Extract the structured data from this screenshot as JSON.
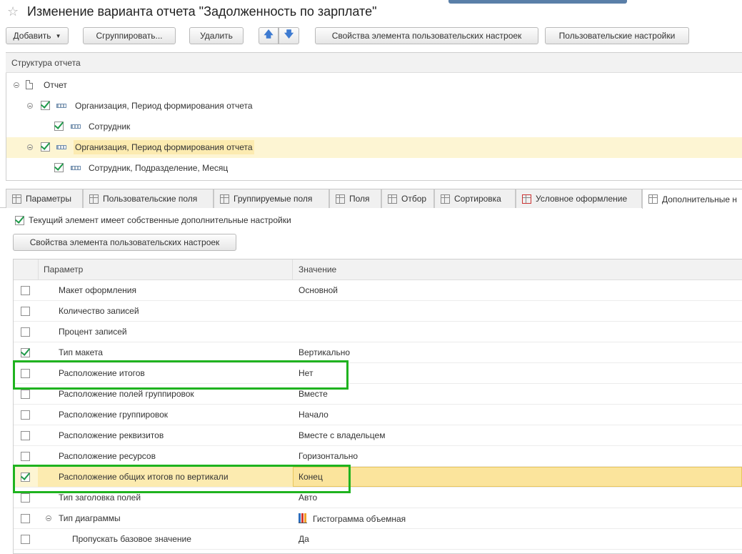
{
  "title": "Изменение варианта отчета \"Задолженность по зарплате\"",
  "toolbar": {
    "add": "Добавить",
    "group": "Сгруппировать...",
    "delete": "Удалить",
    "up_arrow": "🡅",
    "down_arrow": "🡇",
    "element_props": "Свойства элемента пользовательских настроек",
    "user_settings": "Пользовательские настройки"
  },
  "structure": {
    "header": "Структура отчета",
    "items": [
      {
        "label": "Отчет"
      },
      {
        "label": "Организация, Период формирования отчета"
      },
      {
        "label": "Сотрудник"
      },
      {
        "label": "Организация, Период формирования отчета"
      },
      {
        "label": "Сотрудник, Подразделение, Месяц"
      }
    ]
  },
  "tabs": [
    {
      "label": "Параметры"
    },
    {
      "label": "Пользовательские поля"
    },
    {
      "label": "Группируемые поля"
    },
    {
      "label": "Поля"
    },
    {
      "label": "Отбор"
    },
    {
      "label": "Сортировка"
    },
    {
      "label": "Условное оформление"
    },
    {
      "label": "Дополнительные н"
    }
  ],
  "own_settings_label": "Текущий элемент имеет собственные дополнительные настройки",
  "element_props_button": "Свойства элемента пользовательских настроек",
  "grid": {
    "col_param": "Параметр",
    "col_value": "Значение",
    "rows": [
      {
        "param": "Макет оформления",
        "value": "Основной",
        "checked": false
      },
      {
        "param": "Количество записей",
        "value": "",
        "checked": false
      },
      {
        "param": "Процент записей",
        "value": "",
        "checked": false
      },
      {
        "param": "Тип макета",
        "value": "Вертикально",
        "checked": true
      },
      {
        "param": "Расположение итогов",
        "value": "Нет",
        "checked": false
      },
      {
        "param": "Расположение полей группировок",
        "value": "Вместе",
        "checked": false
      },
      {
        "param": "Расположение группировок",
        "value": "Начало",
        "checked": false
      },
      {
        "param": "Расположение реквизитов",
        "value": "Вместе с владельцем",
        "checked": false
      },
      {
        "param": "Расположение ресурсов",
        "value": "Горизонтально",
        "checked": false
      },
      {
        "param": "Расположение общих итогов по вертикали",
        "value": "Конец",
        "checked": true
      },
      {
        "param": "Тип заголовка полей",
        "value": "Авто",
        "checked": false
      },
      {
        "param": "Тип диаграммы",
        "value": "Гистограмма объемная",
        "checked": false
      },
      {
        "param": "Пропускать базовое значение",
        "value": "Да",
        "checked": false
      }
    ]
  },
  "colors": {
    "highlight_frame": "#1fb31f",
    "selected_row": "#fdf5d3",
    "selected_cell": "#fbe49c",
    "check": "#1f9a4a"
  }
}
